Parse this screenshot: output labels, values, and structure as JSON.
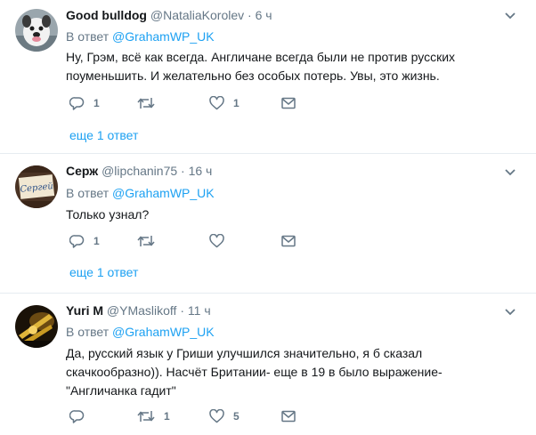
{
  "tweets": [
    {
      "name": "Good bulldog",
      "handle": "@NataliaKorolev",
      "separator": "·",
      "time": "6 ч",
      "reply_prefix": "В ответ",
      "reply_to": "@GrahamWP_UK",
      "lines": [
        "Ну, Грэм, всё как всегда. Англичане всегда были не против русских",
        "поуменьшить. И желательно без особых потерь. Увы, это жизнь."
      ],
      "counts": {
        "reply": "1",
        "retweet": "",
        "like": "1"
      },
      "more_replies": "еще 1 ответ"
    },
    {
      "name": "Серж",
      "handle": "@lipchanin75",
      "separator": "·",
      "time": "16 ч",
      "reply_prefix": "В ответ",
      "reply_to": "@GrahamWP_UK",
      "lines": [
        "Только узнал?"
      ],
      "counts": {
        "reply": "1",
        "retweet": "",
        "like": ""
      },
      "more_replies": "еще 1 ответ",
      "avatar_text": "Сергей"
    },
    {
      "name": "Yuri M",
      "handle": "@YMaslikoff",
      "separator": "·",
      "time": "11 ч",
      "reply_prefix": "В ответ",
      "reply_to": "@GrahamWP_UK",
      "lines": [
        "Да, русский язык у Гриши улучшился значительно, я б сказал",
        "скачкообразно)). Насчёт Британии- еще в 19 в было выражение-",
        "\"Англичанка гадит\""
      ],
      "counts": {
        "reply": "",
        "retweet": "1",
        "like": "5"
      }
    }
  ],
  "icons": {
    "reply": "reply-icon",
    "retweet": "retweet-icon",
    "like": "heart-icon",
    "message": "envelope-icon",
    "menu": "chevron-down-icon"
  },
  "colors": {
    "link": "#1da1f2",
    "secondary_text": "#657786",
    "primary_text": "#14171a",
    "divider": "#e6ecf0"
  }
}
